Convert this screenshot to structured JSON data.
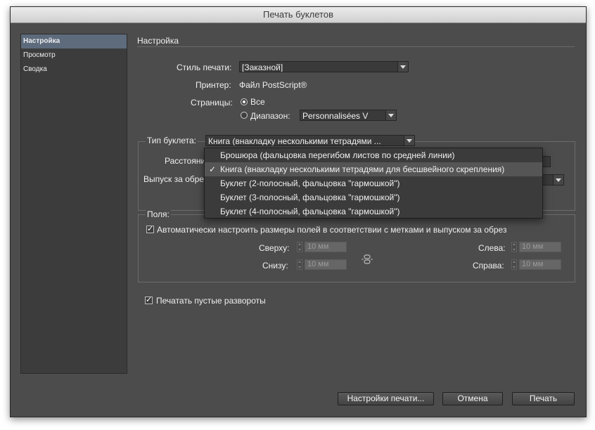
{
  "window": {
    "title": "Печать буклетов"
  },
  "sidebar": {
    "items": [
      {
        "label": "Настройка",
        "selected": true
      },
      {
        "label": "Просмотр",
        "selected": false
      },
      {
        "label": "Сводка",
        "selected": false
      }
    ]
  },
  "setup": {
    "section_title": "Настройка",
    "print_style_label": "Стиль печати:",
    "print_style_value": "[Заказной]",
    "printer_label": "Принтер:",
    "printer_value": "Файл PostScript®",
    "pages_label": "Страницы:",
    "pages_all_label": "Все",
    "pages_range_label": "Диапазон:",
    "pages_range_value": "Personnalisées V"
  },
  "booklet": {
    "type_label": "Тип буклета:",
    "type_value": "Книга (внакладку несколькими тетрадями ...",
    "spacing_label": "Расстояни",
    "bleed_label": "Выпуск за обре",
    "menu": [
      {
        "label": "Брошюра (фальцовка перегибом листов по средней линии)",
        "checked": false
      },
      {
        "label": "Книга (внакладку несколькими тетрадями для бесшвейного скрепления)",
        "checked": true
      },
      {
        "label": "Буклет (2-полосный, фальцовка \"гармошкой\")",
        "checked": false
      },
      {
        "label": "Буклет (3-полосный, фальцовка \"гармошкой\")",
        "checked": false
      },
      {
        "label": "Буклет (4-полосный, фальцовка \"гармошкой\")",
        "checked": false
      }
    ],
    "check_mark": "✓"
  },
  "margins": {
    "group_label": "Поля:",
    "auto_label": "Автоматически настроить размеры полей в соответствии с метками и выпуском за обрез",
    "top_label": "Сверху:",
    "top_value": "10 мм",
    "bottom_label": "Снизу:",
    "bottom_value": "10 мм",
    "left_label": "Слева:",
    "left_value": "10 мм",
    "right_label": "Справа:",
    "right_value": "10 мм"
  },
  "print_blank_label": "Печатать пустые развороты",
  "buttons": {
    "print_settings": "Настройки печати...",
    "cancel": "Отмена",
    "print": "Печать"
  },
  "colors": {
    "window_bg": "#4c4c4c",
    "sidebar_selected": "#5d6b7d",
    "field_bg": "#3a3a3a"
  }
}
